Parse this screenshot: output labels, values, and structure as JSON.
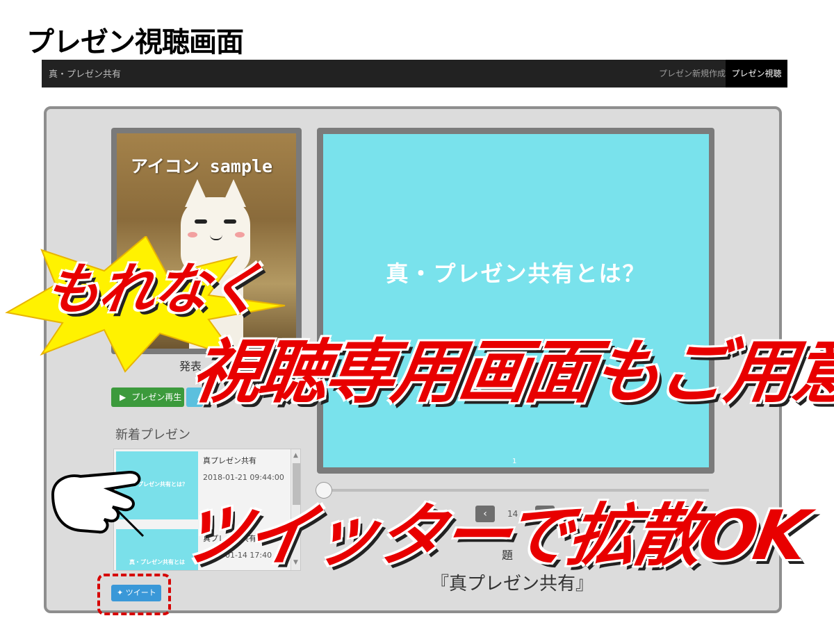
{
  "page_heading": "プレゼン視聴画面",
  "navbar": {
    "brand": "真・プレゼン共有",
    "links": [
      {
        "label": "プレゼン新規作成"
      },
      {
        "label": "プレゼン視聴"
      }
    ]
  },
  "sidebar": {
    "icon_caption": "アイコン sample",
    "presenter_label": "発表",
    "play_button": "プレゼン再生",
    "new_heading": "新着プレゼン",
    "items": [
      {
        "thumb_text": "真・プレゼン共有とは？",
        "title": "真プレゼン共有",
        "date": "2018-01-21 09:44:00"
      },
      {
        "thumb_text": "真・プレゼン共有とは",
        "title": "真プレゼン共有",
        "date": "2018-01-14 17:40"
      }
    ],
    "tweet_button": "ツイート"
  },
  "viewer": {
    "slide_title": "真・プレゼン共有とは？",
    "slide_page": "1",
    "page_info": "14",
    "topic_label": "題",
    "deck_title": "『真プレゼン共有』"
  },
  "promo": {
    "line1": "もれなく",
    "line2": "視聴専用画面もご用意！！",
    "line3": "ツイッターで拡散OK"
  },
  "colors": {
    "navbar": "#222222",
    "slide": "#79e2ec",
    "play_button": "#3c9a3c",
    "tweet_button": "#3a98d8",
    "promo_red": "#e80000",
    "burst_yellow": "#fff200"
  }
}
